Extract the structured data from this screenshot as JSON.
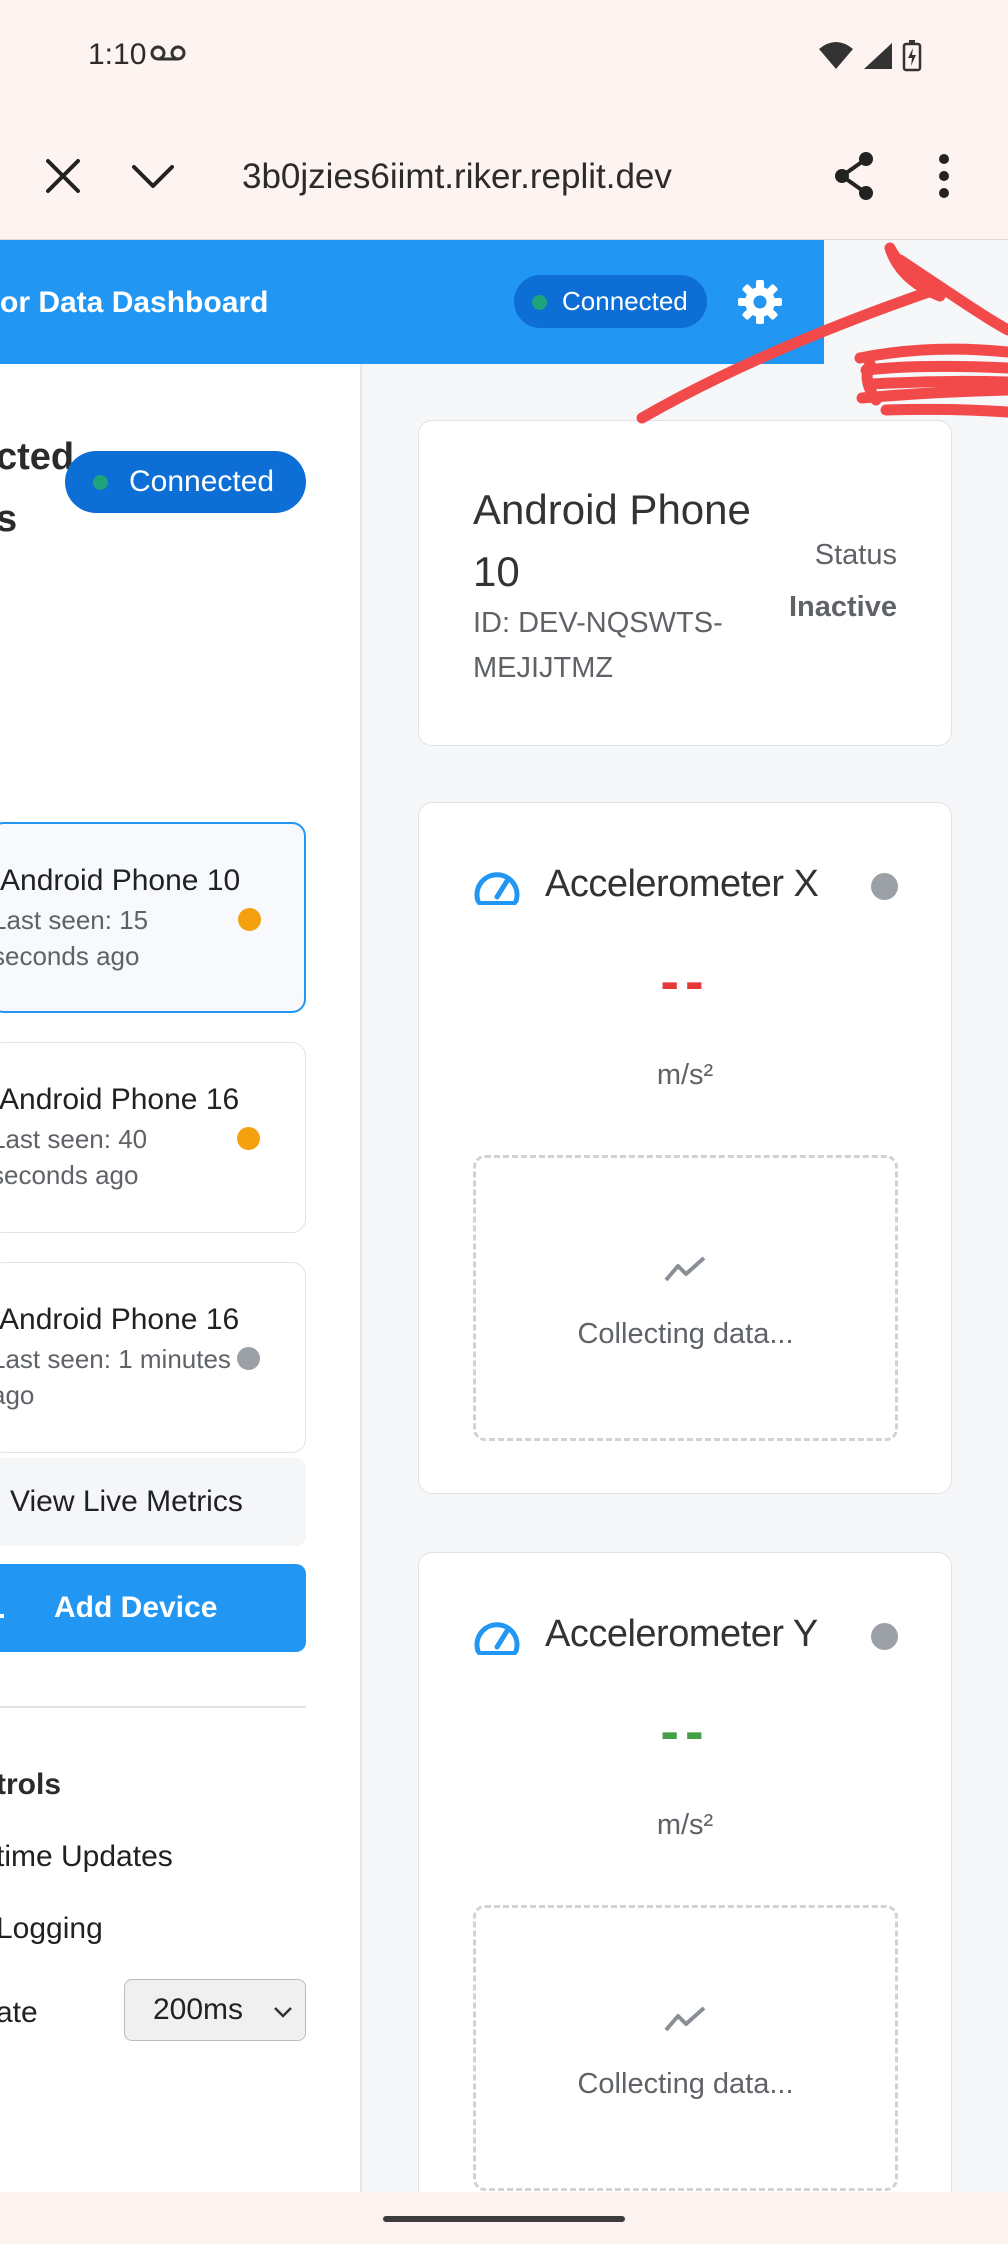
{
  "status_bar": {
    "time": "1:10",
    "icons": [
      "voicemail-icon",
      "wifi-icon",
      "signal-icon",
      "battery-charging-icon"
    ]
  },
  "browser": {
    "url": "3b0jzies6iimt.riker.replit.dev",
    "icons": [
      "close-icon",
      "chevron-down-icon",
      "share-icon",
      "more-vert-icon"
    ]
  },
  "header": {
    "title": "or Data Dashboard",
    "connection_status": "Connected",
    "settings_icon": "gear-icon",
    "color": "#2196f3"
  },
  "sidebar": {
    "heading": "cted\ns",
    "connection_status": "Connected",
    "devices": [
      {
        "name": "Android Phone 10",
        "last_seen": "Last seen: 15 seconds ago",
        "status_color": "#f5a00f",
        "selected": true
      },
      {
        "name": "Android Phone 16",
        "last_seen": "Last seen: 40 seconds ago",
        "status_color": "#f5a00f",
        "selected": false
      },
      {
        "name": "Android Phone 16",
        "last_seen": "Last seen: 1 minutes ago",
        "status_color": "#9aa0a6",
        "selected": false
      }
    ],
    "view_live_label": "View Live Metrics",
    "add_device_label": "Add Device",
    "add_device_icon": "plus-icon",
    "controls_title": "trols",
    "realtime_label": "time Updates",
    "logging_label": "Logging",
    "rate_label": "ate",
    "rate_value": "200ms"
  },
  "device_info": {
    "name": "Android Phone 10",
    "id": "ID: DEV-NQSWTS-MEJIJTMZ",
    "status_label": "Status",
    "status_value": "Inactive"
  },
  "sensors": [
    {
      "title": "Accelerometer X",
      "value": "--",
      "unit": "m/s²",
      "value_color": "#e53935",
      "placeholder": "Collecting data...",
      "icon": "speedometer-icon"
    },
    {
      "title": "Accelerometer Y",
      "value": "--",
      "unit": "m/s²",
      "value_color": "#43a047",
      "placeholder": "Collecting data...",
      "icon": "speedometer-icon"
    }
  ]
}
